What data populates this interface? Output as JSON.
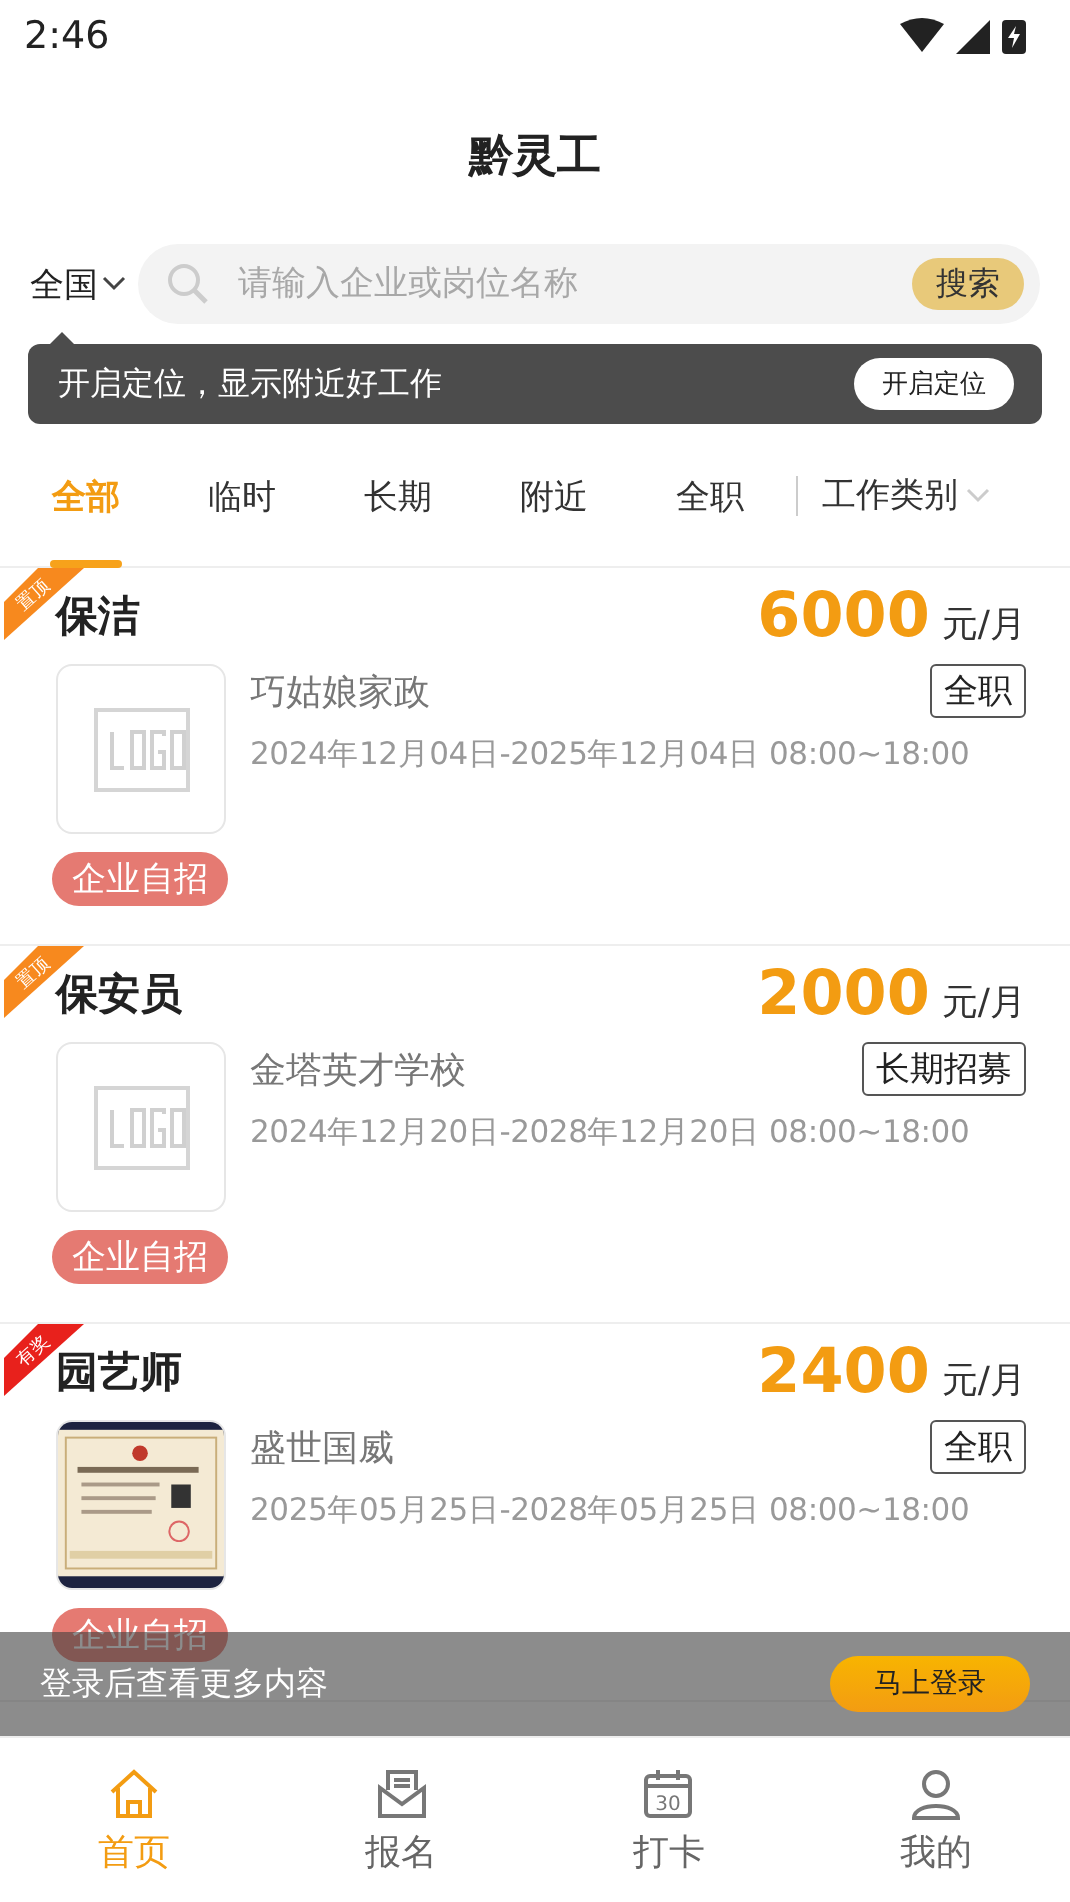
{
  "status_bar": {
    "time": "2:46"
  },
  "header": {
    "title": "黔灵工"
  },
  "search": {
    "region": "全国",
    "placeholder": "请输入企业或岗位名称",
    "button": "搜索"
  },
  "location_tip": {
    "text": "开启定位，显示附近好工作",
    "button": "开启定位"
  },
  "tabs": [
    {
      "label": "全部",
      "selected": true
    },
    {
      "label": "临时",
      "selected": false
    },
    {
      "label": "长期",
      "selected": false
    },
    {
      "label": "附近",
      "selected": false
    },
    {
      "label": "全职",
      "selected": false
    }
  ],
  "category_filter": "工作类别",
  "jobs": [
    {
      "ribbon": {
        "text": "置顶",
        "color": "#f7891e"
      },
      "title": "保洁",
      "salary": "6000",
      "unit": "元/月",
      "company": "巧姑娘家政",
      "logo": {
        "kind": "placeholder"
      },
      "type": "全职",
      "period": "2024年12月04日-2025年12月04日 08:00~18:00",
      "tag": "企业自招"
    },
    {
      "ribbon": {
        "text": "置顶",
        "color": "#f7891e"
      },
      "title": "保安员",
      "salary": "2000",
      "unit": "元/月",
      "company": "金塔英才学校",
      "logo": {
        "kind": "placeholder"
      },
      "type": "长期招募",
      "period": "2024年12月20日-2028年12月20日 08:00~18:00",
      "tag": "企业自招"
    },
    {
      "ribbon": {
        "text": "有奖",
        "color": "#e8211c"
      },
      "title": "园艺师",
      "salary": "2400",
      "unit": "元/月",
      "company": "盛世国威",
      "type": "全职",
      "period": "2025年05月25日-2028年05月25日 08:00~18:00",
      "tag": "企业自招"
    }
  ],
  "login_banner": {
    "text": "登录后查看更多内容",
    "button": "马上登录"
  },
  "bottom_nav": [
    {
      "label": "首页",
      "kind": "home",
      "selected": true
    },
    {
      "label": "报名",
      "kind": "mail",
      "selected": false
    },
    {
      "label": "打卡",
      "kind": "calendar",
      "selected": false,
      "icon_text": "30"
    },
    {
      "label": "我的",
      "kind": "user",
      "selected": false
    }
  ]
}
